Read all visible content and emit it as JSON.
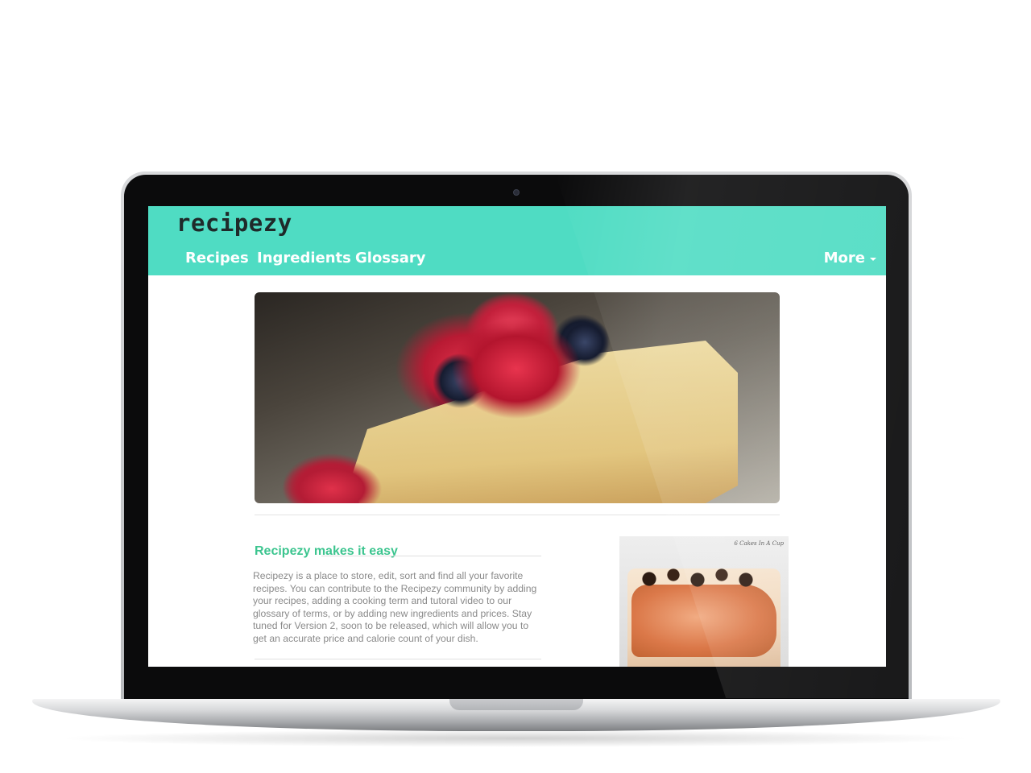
{
  "site": {
    "brand": "recipezy"
  },
  "nav": {
    "recipes": "Recipes",
    "ingredients": "Ingredients",
    "glossary": "Glossary",
    "more": "More"
  },
  "intro": {
    "heading": "Recipezy makes it easy",
    "body": "Recipezy is a place to store, edit, sort and find all your favorite recipes. You can contribute to the Recipezy community by adding your recipes, adding a cooking term and tutoral video to our glossary of terms, or by adding new ingredients and prices. Stay tuned for Version 2, soon to be released, which will allow you to get an accurate price and calorie count of your dish."
  },
  "thumbnail": {
    "caption": "6 Cakes In A Cup"
  },
  "colors": {
    "navbar": "#4fdcc3",
    "heading_accent": "#3cc58f",
    "brand_text": "#1f2a2a"
  },
  "icons": {
    "more_caret": "chevron-down-icon",
    "camera": "camera-icon"
  }
}
